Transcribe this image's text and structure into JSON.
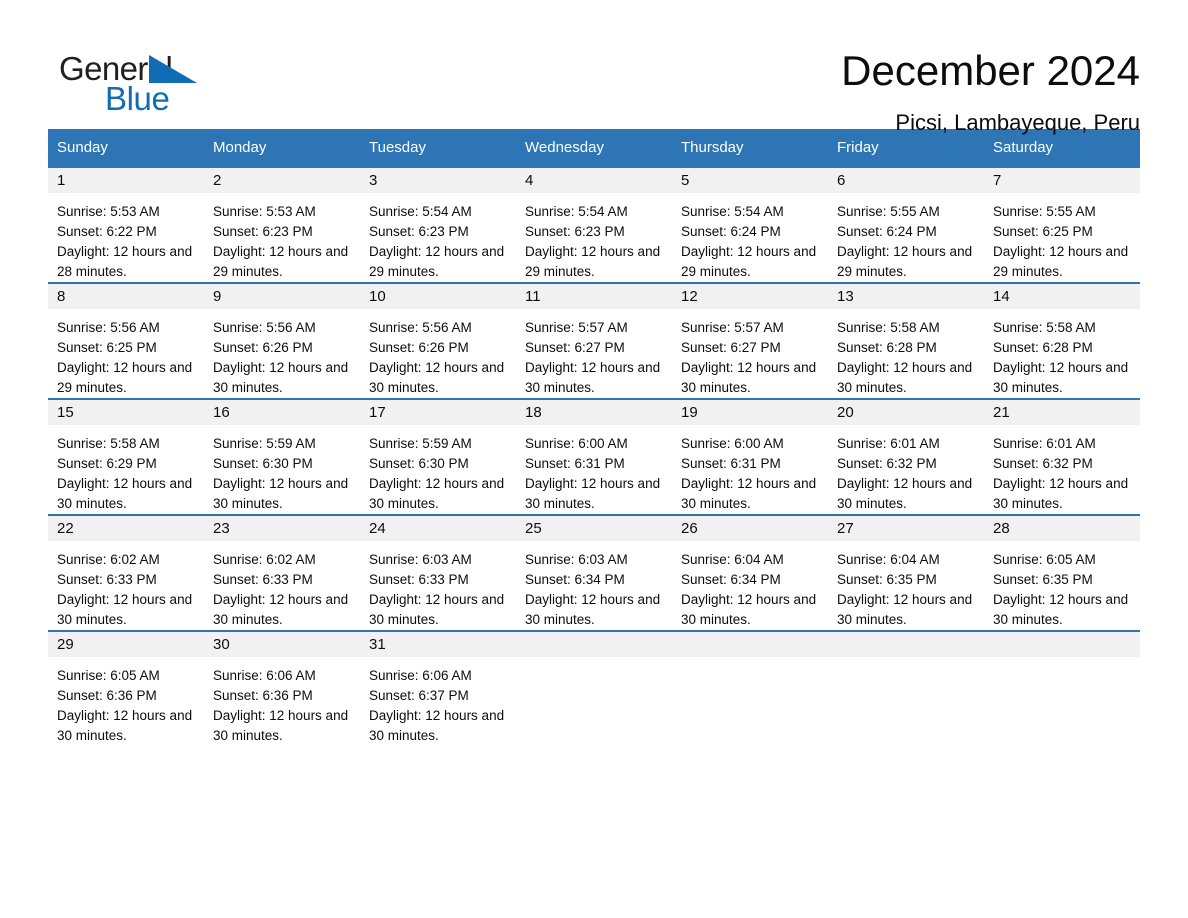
{
  "brand": {
    "name_part1": "General",
    "name_part2": "Blue",
    "triangle_icon": "triangle-icon",
    "accent_color": "#0f6cb5"
  },
  "header": {
    "title": "December 2024",
    "subtitle": "Picsi, Lambayeque, Peru"
  },
  "colors": {
    "header_row": "#2e75b6",
    "day_band": "#f1f1f1",
    "row_divider": "#2e75b6",
    "text": "#0d0d0d"
  },
  "weekday_headers": [
    "Sunday",
    "Monday",
    "Tuesday",
    "Wednesday",
    "Thursday",
    "Friday",
    "Saturday"
  ],
  "weeks": [
    [
      {
        "day": "1",
        "sunrise": "Sunrise: 5:53 AM",
        "sunset": "Sunset: 6:22 PM",
        "daylight": "Daylight: 12 hours and 28 minutes."
      },
      {
        "day": "2",
        "sunrise": "Sunrise: 5:53 AM",
        "sunset": "Sunset: 6:23 PM",
        "daylight": "Daylight: 12 hours and 29 minutes."
      },
      {
        "day": "3",
        "sunrise": "Sunrise: 5:54 AM",
        "sunset": "Sunset: 6:23 PM",
        "daylight": "Daylight: 12 hours and 29 minutes."
      },
      {
        "day": "4",
        "sunrise": "Sunrise: 5:54 AM",
        "sunset": "Sunset: 6:23 PM",
        "daylight": "Daylight: 12 hours and 29 minutes."
      },
      {
        "day": "5",
        "sunrise": "Sunrise: 5:54 AM",
        "sunset": "Sunset: 6:24 PM",
        "daylight": "Daylight: 12 hours and 29 minutes."
      },
      {
        "day": "6",
        "sunrise": "Sunrise: 5:55 AM",
        "sunset": "Sunset: 6:24 PM",
        "daylight": "Daylight: 12 hours and 29 minutes."
      },
      {
        "day": "7",
        "sunrise": "Sunrise: 5:55 AM",
        "sunset": "Sunset: 6:25 PM",
        "daylight": "Daylight: 12 hours and 29 minutes."
      }
    ],
    [
      {
        "day": "8",
        "sunrise": "Sunrise: 5:56 AM",
        "sunset": "Sunset: 6:25 PM",
        "daylight": "Daylight: 12 hours and 29 minutes."
      },
      {
        "day": "9",
        "sunrise": "Sunrise: 5:56 AM",
        "sunset": "Sunset: 6:26 PM",
        "daylight": "Daylight: 12 hours and 30 minutes."
      },
      {
        "day": "10",
        "sunrise": "Sunrise: 5:56 AM",
        "sunset": "Sunset: 6:26 PM",
        "daylight": "Daylight: 12 hours and 30 minutes."
      },
      {
        "day": "11",
        "sunrise": "Sunrise: 5:57 AM",
        "sunset": "Sunset: 6:27 PM",
        "daylight": "Daylight: 12 hours and 30 minutes."
      },
      {
        "day": "12",
        "sunrise": "Sunrise: 5:57 AM",
        "sunset": "Sunset: 6:27 PM",
        "daylight": "Daylight: 12 hours and 30 minutes."
      },
      {
        "day": "13",
        "sunrise": "Sunrise: 5:58 AM",
        "sunset": "Sunset: 6:28 PM",
        "daylight": "Daylight: 12 hours and 30 minutes."
      },
      {
        "day": "14",
        "sunrise": "Sunrise: 5:58 AM",
        "sunset": "Sunset: 6:28 PM",
        "daylight": "Daylight: 12 hours and 30 minutes."
      }
    ],
    [
      {
        "day": "15",
        "sunrise": "Sunrise: 5:58 AM",
        "sunset": "Sunset: 6:29 PM",
        "daylight": "Daylight: 12 hours and 30 minutes."
      },
      {
        "day": "16",
        "sunrise": "Sunrise: 5:59 AM",
        "sunset": "Sunset: 6:30 PM",
        "daylight": "Daylight: 12 hours and 30 minutes."
      },
      {
        "day": "17",
        "sunrise": "Sunrise: 5:59 AM",
        "sunset": "Sunset: 6:30 PM",
        "daylight": "Daylight: 12 hours and 30 minutes."
      },
      {
        "day": "18",
        "sunrise": "Sunrise: 6:00 AM",
        "sunset": "Sunset: 6:31 PM",
        "daylight": "Daylight: 12 hours and 30 minutes."
      },
      {
        "day": "19",
        "sunrise": "Sunrise: 6:00 AM",
        "sunset": "Sunset: 6:31 PM",
        "daylight": "Daylight: 12 hours and 30 minutes."
      },
      {
        "day": "20",
        "sunrise": "Sunrise: 6:01 AM",
        "sunset": "Sunset: 6:32 PM",
        "daylight": "Daylight: 12 hours and 30 minutes."
      },
      {
        "day": "21",
        "sunrise": "Sunrise: 6:01 AM",
        "sunset": "Sunset: 6:32 PM",
        "daylight": "Daylight: 12 hours and 30 minutes."
      }
    ],
    [
      {
        "day": "22",
        "sunrise": "Sunrise: 6:02 AM",
        "sunset": "Sunset: 6:33 PM",
        "daylight": "Daylight: 12 hours and 30 minutes."
      },
      {
        "day": "23",
        "sunrise": "Sunrise: 6:02 AM",
        "sunset": "Sunset: 6:33 PM",
        "daylight": "Daylight: 12 hours and 30 minutes."
      },
      {
        "day": "24",
        "sunrise": "Sunrise: 6:03 AM",
        "sunset": "Sunset: 6:33 PM",
        "daylight": "Daylight: 12 hours and 30 minutes."
      },
      {
        "day": "25",
        "sunrise": "Sunrise: 6:03 AM",
        "sunset": "Sunset: 6:34 PM",
        "daylight": "Daylight: 12 hours and 30 minutes."
      },
      {
        "day": "26",
        "sunrise": "Sunrise: 6:04 AM",
        "sunset": "Sunset: 6:34 PM",
        "daylight": "Daylight: 12 hours and 30 minutes."
      },
      {
        "day": "27",
        "sunrise": "Sunrise: 6:04 AM",
        "sunset": "Sunset: 6:35 PM",
        "daylight": "Daylight: 12 hours and 30 minutes."
      },
      {
        "day": "28",
        "sunrise": "Sunrise: 6:05 AM",
        "sunset": "Sunset: 6:35 PM",
        "daylight": "Daylight: 12 hours and 30 minutes."
      }
    ],
    [
      {
        "day": "29",
        "sunrise": "Sunrise: 6:05 AM",
        "sunset": "Sunset: 6:36 PM",
        "daylight": "Daylight: 12 hours and 30 minutes."
      },
      {
        "day": "30",
        "sunrise": "Sunrise: 6:06 AM",
        "sunset": "Sunset: 6:36 PM",
        "daylight": "Daylight: 12 hours and 30 minutes."
      },
      {
        "day": "31",
        "sunrise": "Sunrise: 6:06 AM",
        "sunset": "Sunset: 6:37 PM",
        "daylight": "Daylight: 12 hours and 30 minutes."
      },
      {
        "day": "",
        "sunrise": "",
        "sunset": "",
        "daylight": ""
      },
      {
        "day": "",
        "sunrise": "",
        "sunset": "",
        "daylight": ""
      },
      {
        "day": "",
        "sunrise": "",
        "sunset": "",
        "daylight": ""
      },
      {
        "day": "",
        "sunrise": "",
        "sunset": "",
        "daylight": ""
      }
    ]
  ]
}
